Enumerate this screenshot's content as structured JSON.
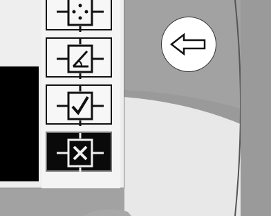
{
  "screen": {
    "background_color": "#a2a2a2",
    "panel_color": "#eeeeee",
    "tools": [
      {
        "icon": "move-crosshair-icon",
        "state": "normal"
      },
      {
        "icon": "angle-tool-icon",
        "state": "normal"
      },
      {
        "icon": "confirm-check-icon",
        "state": "normal"
      },
      {
        "icon": "cancel-x-icon",
        "state": "active"
      }
    ],
    "back_button": {
      "icon": "left-arrow-icon"
    }
  }
}
